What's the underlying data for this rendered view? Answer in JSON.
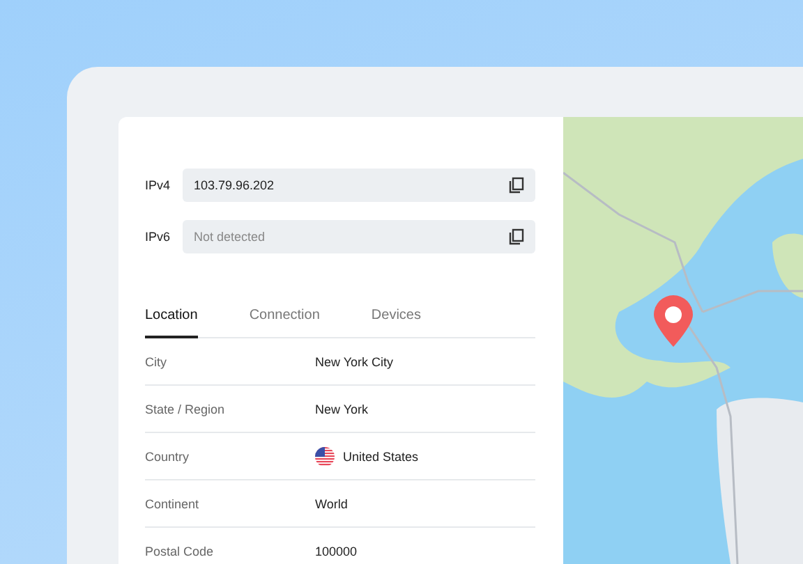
{
  "ip_fields": [
    {
      "label": "IPv4",
      "value": "103.79.96.202"
    },
    {
      "label": "IPv6",
      "placeholder": "Not detected"
    }
  ],
  "tabs": [
    {
      "label": "Location",
      "selected": true
    },
    {
      "label": "Connection",
      "selected": false
    },
    {
      "label": "Devices",
      "selected": false
    }
  ],
  "details": [
    {
      "label": "City",
      "value": "New York City",
      "kind": "text"
    },
    {
      "label": "State / Region",
      "value": "New York",
      "kind": "text"
    },
    {
      "label": "Country",
      "value": "United States",
      "kind": "flag"
    },
    {
      "label": "Continent",
      "value": "World",
      "kind": "text"
    },
    {
      "label": "Postal Code",
      "value": "100000",
      "kind": "text"
    }
  ]
}
